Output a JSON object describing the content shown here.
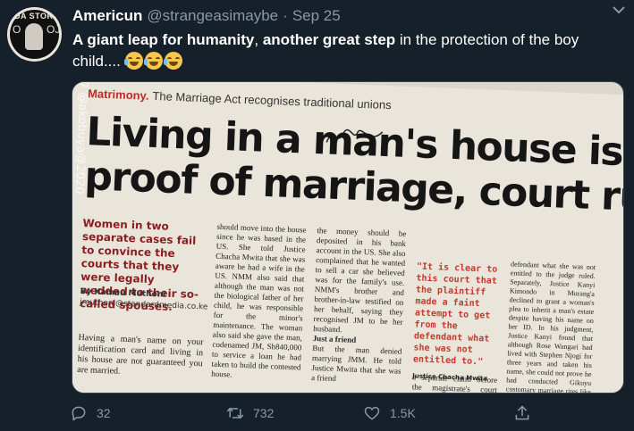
{
  "tweet": {
    "author_name": "Americun",
    "handle": "@strangeasimaybe",
    "separator": "·",
    "date": "Sep 25",
    "text_bold_1": "A giant leap for humanity",
    "text_comma": ", ",
    "text_bold_2": "another great step",
    "text_rest": " in the protection of the boy child....",
    "emoji_icon": "face-with-tears-of-joy-icon"
  },
  "avatar": {
    "badge_text": "DA STORY",
    "dots_left": "O",
    "dots_right": "OJ"
  },
  "media": {
    "kicker": "Matrimony.",
    "kicker_rest": "The Marriage Act recognises traditional unions",
    "headline_line1": "Living in a man's house is not",
    "headline_line2": "proof of marriage, court rules",
    "watermark": "7 @akobuya@2020",
    "lead": "Women in two separate cases fail to convince the courts that they were legally wedded to their so-called spouses.",
    "byline_name": "By Kamau Muthoni",
    "byline_email": "jmuthoni@standardmedia.co.ke",
    "col1": "Having a man's name on your identification card and living in his house are not guaranteed you are married.",
    "col2": "should move into the house since he was based in the US. She told Justice Chacha Mwita that she was aware he had a wife in the US. NMM also said that although the man was not the biological father of her child, he was responsible for the minor's maintenance. The woman also said she gave the man, codenamed JM, Sh840,000 to service a loan he had taken to build the contested house.",
    "col3": "the money should be deposited in his bank account in the US. She also complained that he wanted to sell a car she believed was for the family's use. NMM's brother and brother-in-law testified on her behalf, saying they recognised JM to be her husband.",
    "col3_sub": "Just a friend",
    "col3_b": "But the man denied marrying JMM. He told Justice Mwita that she was a friend",
    "quote": "\"It is clear to this court that the plaintiff made a faint attempt to get from the defendant what she was not entitled to.\"",
    "quote_attr": "Justice Chacha Mwita",
    "col4": "a separate claim before the magistrate's court seeking",
    "col5": "defendant what she was not entitled to the judge ruled. Separately, Justice Kanyi Kimondo in Murang'a declined to grant a woman's plea to inherit a man's estate despite having his name on her ID. In his judgment, Justice Kanyi found that although Rose Wangari had lived with Stephen Njogi for three years and taken his name, she could not prove he had conducted Gikuyu customary marriage rites like paying bride price. The woman had brought a case in a Murang'a court"
  },
  "actions": {
    "reply_count": "32",
    "retweet_count": "732",
    "like_count": "1.5K",
    "reply_icon": "reply-icon",
    "retweet_icon": "retweet-icon",
    "like_icon": "heart-icon",
    "share_icon": "share-icon",
    "caret_icon": "chevron-down-icon"
  },
  "colors": {
    "background": "#15202b",
    "secondary_text": "#8899a6",
    "border": "#38444d",
    "kicker_red": "#c02a2a"
  }
}
